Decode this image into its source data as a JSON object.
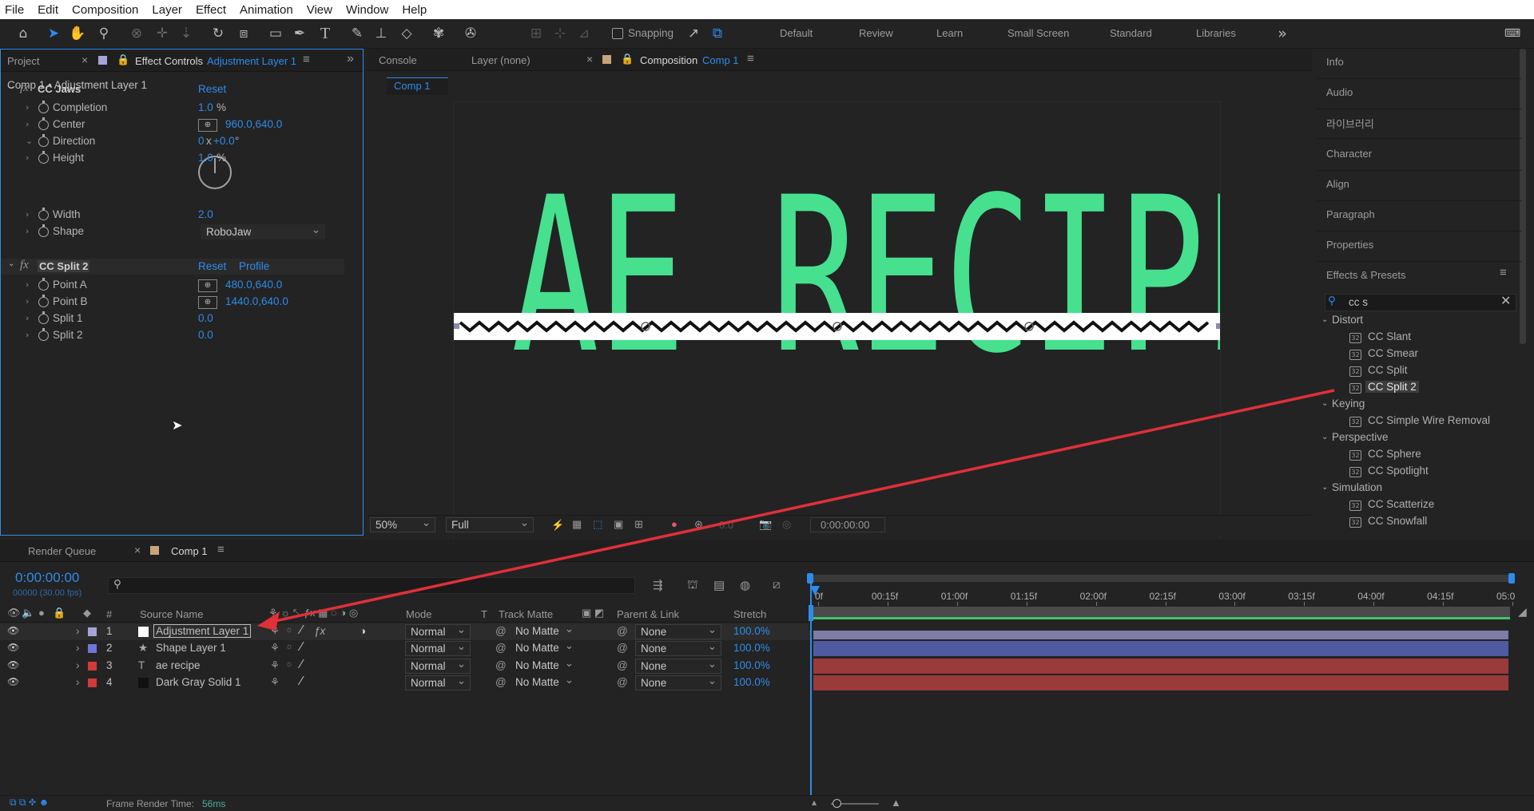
{
  "menu": [
    "File",
    "Edit",
    "Composition",
    "Layer",
    "Effect",
    "Animation",
    "View",
    "Window",
    "Help"
  ],
  "toolbar": {
    "snapping": "Snapping",
    "workspaces": [
      "Default",
      "Review",
      "Learn",
      "Small Screen",
      "Standard",
      "Libraries"
    ]
  },
  "left_panel": {
    "tab_project": "Project",
    "tab_effect_controls": "Effect Controls",
    "tab_effect_layer": "Adjustment Layer 1",
    "breadcrumb": "Comp 1 • Adjustment Layer 1",
    "effects": [
      {
        "name": "CC Jaws",
        "reset": "Reset",
        "props": [
          {
            "label": "Completion",
            "value": "1.0",
            "unit": "%"
          },
          {
            "label": "Center",
            "value": "960.0,640.0"
          },
          {
            "label": "Direction",
            "value": "0",
            "value2": "+0.0",
            "x": "x",
            "deg": "°"
          },
          {
            "label": "Height",
            "value": "1.0",
            "unit": "%"
          },
          {
            "label": "Width",
            "value": "2.0"
          },
          {
            "label": "Shape",
            "value": "RoboJaw"
          }
        ]
      },
      {
        "name": "CC Split 2",
        "reset": "Reset",
        "profile": "Profile",
        "props": [
          {
            "label": "Point A",
            "value": "480.0,640.0"
          },
          {
            "label": "Point B",
            "value": "1440.0,640.0"
          },
          {
            "label": "Split 1",
            "value": "0.0"
          },
          {
            "label": "Split 2",
            "value": "0.0"
          }
        ]
      }
    ]
  },
  "center_panel": {
    "tab_console": "Console",
    "tab_layer": "Layer (none)",
    "tab_comp": "Composition",
    "tab_comp_name": "Comp 1",
    "subtab": "Comp 1",
    "zoom": "50%",
    "quality": "Full",
    "exposure": "0.0",
    "timecode": "0:00:00:00",
    "comp_text": "AE RECIPE"
  },
  "right_panel": {
    "items": [
      "Info",
      "Audio",
      "라이브러리",
      "Character",
      "Align",
      "Paragraph",
      "Properties"
    ],
    "effects_presets": "Effects & Presets",
    "search": "cc s",
    "groups": [
      {
        "name": "Distort",
        "items": [
          "CC Slant",
          "CC Smear",
          "CC Split",
          "CC Split 2"
        ]
      },
      {
        "name": "Keying",
        "items": [
          "CC Simple Wire Removal"
        ]
      },
      {
        "name": "Perspective",
        "items": [
          "CC Sphere",
          "CC Spotlight"
        ]
      },
      {
        "name": "Simulation",
        "items": [
          "CC Scatterize",
          "CC Snowfall"
        ]
      }
    ]
  },
  "timeline": {
    "tab_render": "Render Queue",
    "tab_comp": "Comp 1",
    "timecode": "0:00:00:00",
    "fps": "00000 (30.00 fps)",
    "col_headers": {
      "num": "#",
      "source": "Source Name",
      "mode": "Mode",
      "t": "T",
      "track_matte": "Track Matte",
      "parent": "Parent & Link",
      "stretch": "Stretch"
    },
    "ruler": [
      "0f",
      "00:15f",
      "01:00f",
      "01:15f",
      "02:00f",
      "02:15f",
      "03:00f",
      "03:15f",
      "04:00f",
      "04:15f",
      "05:0"
    ],
    "layers": [
      {
        "num": "1",
        "name": "Adjustment Layer 1",
        "mode": "Normal",
        "matte": "No Matte",
        "parent": "None",
        "stretch": "100.0%",
        "color": "#a7a3d9",
        "bar": "#7f7ca8"
      },
      {
        "num": "2",
        "name": "Shape Layer 1",
        "mode": "Normal",
        "matte": "No Matte",
        "parent": "None",
        "stretch": "100.0%",
        "color": "#6e77d6",
        "bar": "#4f5aa0"
      },
      {
        "num": "3",
        "name": "ae recipe",
        "mode": "Normal",
        "matte": "No Matte",
        "parent": "None",
        "stretch": "100.0%",
        "color": "#d23b3b",
        "bar": "#9b3a3a"
      },
      {
        "num": "4",
        "name": "Dark Gray Solid 1",
        "mode": "Normal",
        "matte": "No Matte",
        "parent": "None",
        "stretch": "100.0%",
        "color": "#d23b3b",
        "bar": "#9b3a3a"
      }
    ]
  },
  "status": {
    "frame_render_label": "Frame Render Time:",
    "frame_render_value": "56ms"
  },
  "colors": {
    "accent": "#2d8ceb",
    "comp_text": "#46e08f",
    "arrow": "#e0303a"
  }
}
